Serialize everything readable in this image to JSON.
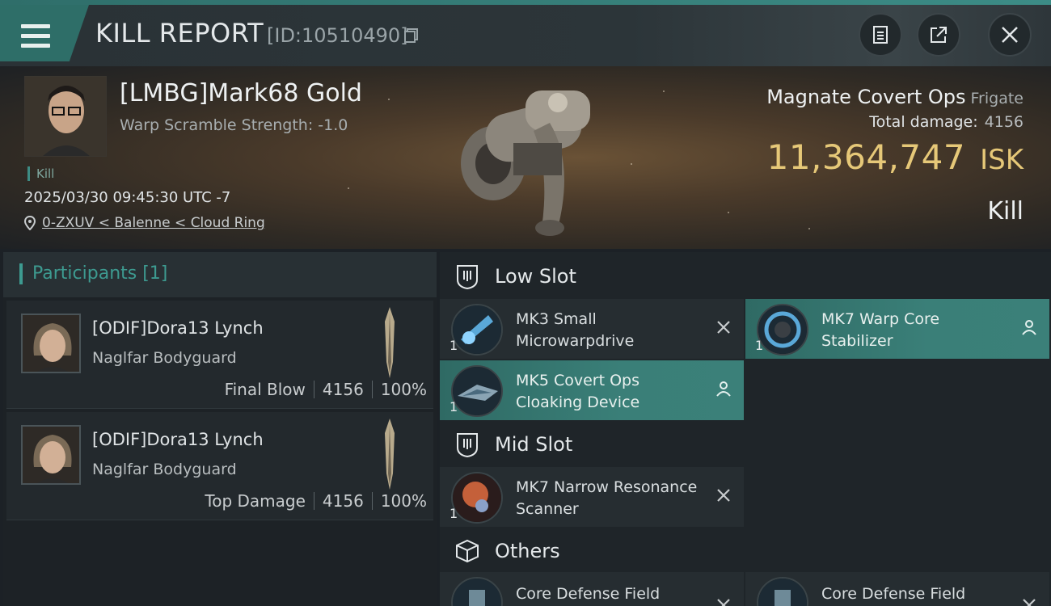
{
  "header": {
    "title": "KILL REPORT",
    "report_id": "[ID:10510490]"
  },
  "victim": {
    "name": "[LMBG]Mark68 Gold",
    "warp_scramble": "Warp Scramble Strength: -1.0",
    "tag": "Kill",
    "timestamp": "2025/03/30 09:45:30 UTC -7",
    "location": "0-ZXUV < Balenne < Cloud Ring",
    "ship_name": "Magnate Covert Ops",
    "ship_class": "Frigate",
    "total_damage_label": "Total damage:",
    "total_damage": "4156",
    "isk_value": "11,364,747",
    "isk_unit": "ISK",
    "result": "Kill"
  },
  "participants": {
    "label": "Participants [1]",
    "items": [
      {
        "name": "[ODIF]Dora13 Lynch",
        "ship": "Naglfar Bodyguard",
        "role": "Final Blow",
        "damage": "4156",
        "percent": "100%"
      },
      {
        "name": "[ODIF]Dora13 Lynch",
        "ship": "Naglfar Bodyguard",
        "role": "Top Damage",
        "damage": "4156",
        "percent": "100%"
      }
    ]
  },
  "slots": {
    "low": {
      "label": "Low Slot",
      "modules": [
        {
          "name": "MK3 Small Microwarpdrive",
          "qty": "1",
          "state": "destroyed"
        },
        {
          "name": "MK7 Warp Core Stabilizer",
          "qty": "1",
          "state": "dropped"
        },
        {
          "name": "MK5 Covert Ops Cloaking Device",
          "qty": "1",
          "state": "dropped"
        }
      ]
    },
    "mid": {
      "label": "Mid Slot",
      "modules": [
        {
          "name": "MK7 Narrow Resonance Scanner",
          "qty": "1",
          "state": "destroyed"
        }
      ]
    },
    "others": {
      "label": "Others",
      "modules": [
        {
          "name": "Core Defense Field",
          "state": "destroyed"
        },
        {
          "name": "Core Defense Field",
          "state": "destroyed"
        }
      ]
    }
  },
  "colors": {
    "accent_teal": "#3d9a90",
    "isk_gold": "#e6c878",
    "active_row": "#3a7f78"
  }
}
